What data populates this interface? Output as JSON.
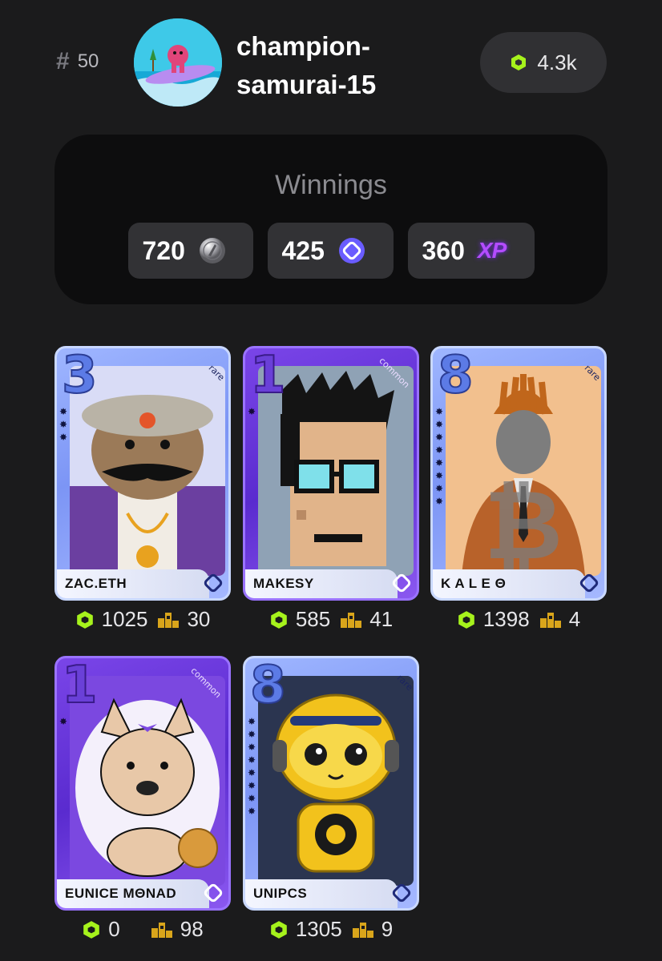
{
  "header": {
    "rank_icon": "hash-icon",
    "rank": "50",
    "username": "champion-samurai-15",
    "points": "4.3k",
    "points_icon": "hexagon-icon"
  },
  "winnings": {
    "title": "Winnings",
    "items": [
      {
        "value": "720",
        "icon": "silver-coin-icon"
      },
      {
        "value": "425",
        "icon": "monad-token-icon"
      },
      {
        "value": "360",
        "icon": "xp-icon",
        "icon_text": "XP"
      }
    ]
  },
  "cards": [
    {
      "level": "3",
      "rarity": "rare",
      "stars": 3,
      "name": "ZAC.ETH",
      "score": "1025",
      "rank": "30"
    },
    {
      "level": "1",
      "rarity": "common",
      "stars": 1,
      "name": "MAKESY",
      "score": "585",
      "rank": "41"
    },
    {
      "level": "8",
      "rarity": "rare",
      "stars": 8,
      "name": "K A L E Θ",
      "score": "1398",
      "rank": "4"
    },
    {
      "level": "1",
      "rarity": "common",
      "stars": 1,
      "name": "EUNICE MΘNAD",
      "score": "0",
      "rank": "98"
    },
    {
      "level": "8",
      "rarity": "rare",
      "stars": 8,
      "name": "UNIPCS",
      "score": "1305",
      "rank": "9"
    }
  ],
  "colors": {
    "background": "#1b1b1c",
    "accent_green": "#a6f21c",
    "rank_gold": "#d9a51b",
    "monad_purple": "#6a5cff",
    "xp_purple": "#b44cff"
  }
}
